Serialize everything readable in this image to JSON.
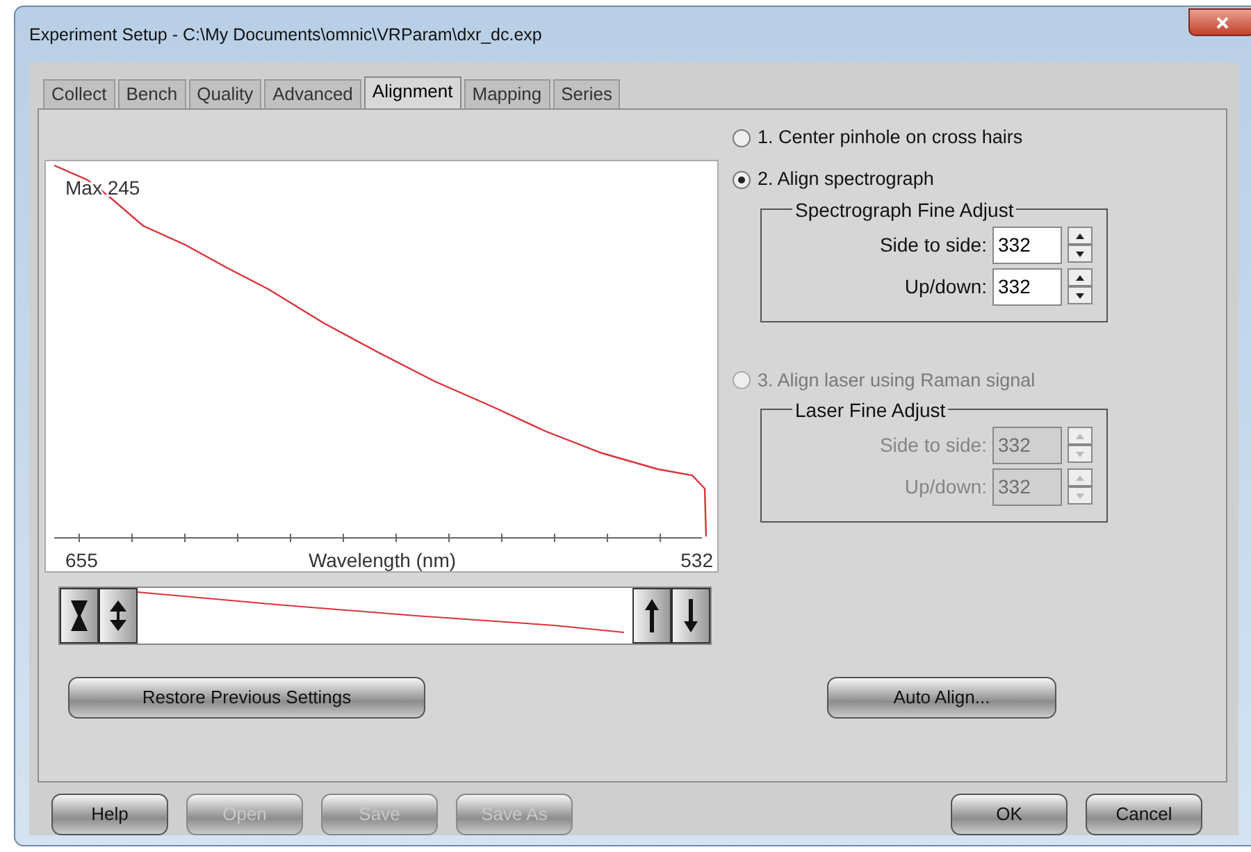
{
  "window": {
    "title": "Experiment Setup - C:\\My Documents\\omnic\\VRParam\\dxr_dc.exp"
  },
  "tabs": [
    {
      "label": "Collect",
      "selected": false
    },
    {
      "label": "Bench",
      "selected": false
    },
    {
      "label": "Quality",
      "selected": false
    },
    {
      "label": "Advanced",
      "selected": false
    },
    {
      "label": "Alignment",
      "selected": true
    },
    {
      "label": "Mapping",
      "selected": false
    },
    {
      "label": "Series",
      "selected": false
    }
  ],
  "plot": {
    "max_label": "Max 245",
    "x_start": "655",
    "x_end": "532",
    "xlabel": "Wavelength (nm)"
  },
  "options": [
    {
      "label": "1. Center pinhole on cross hairs",
      "selected": false,
      "disabled": false
    },
    {
      "label": "2. Align spectrograph",
      "selected": true,
      "disabled": false,
      "group": {
        "title": "Spectrograph Fine Adjust",
        "fields": [
          {
            "label": "Side to side:",
            "value": "332",
            "disabled": false
          },
          {
            "label": "Up/down:",
            "value": "332",
            "disabled": false
          }
        ]
      }
    },
    {
      "label": "3. Align laser using Raman signal",
      "selected": false,
      "disabled": true,
      "group": {
        "title": "Laser Fine Adjust",
        "fields": [
          {
            "label": "Side to side:",
            "value": "332",
            "disabled": true
          },
          {
            "label": "Up/down:",
            "value": "332",
            "disabled": true
          }
        ]
      }
    }
  ],
  "actions": [
    "Restore Previous Settings",
    "Auto Align..."
  ],
  "footer": {
    "left": [
      {
        "label": "Help",
        "disabled": false
      },
      {
        "label": "Open",
        "disabled": true
      },
      {
        "label": "Save",
        "disabled": true
      },
      {
        "label": "Save As",
        "disabled": true
      }
    ],
    "right": [
      {
        "label": "OK",
        "disabled": false
      },
      {
        "label": "Cancel",
        "disabled": false
      }
    ]
  }
}
